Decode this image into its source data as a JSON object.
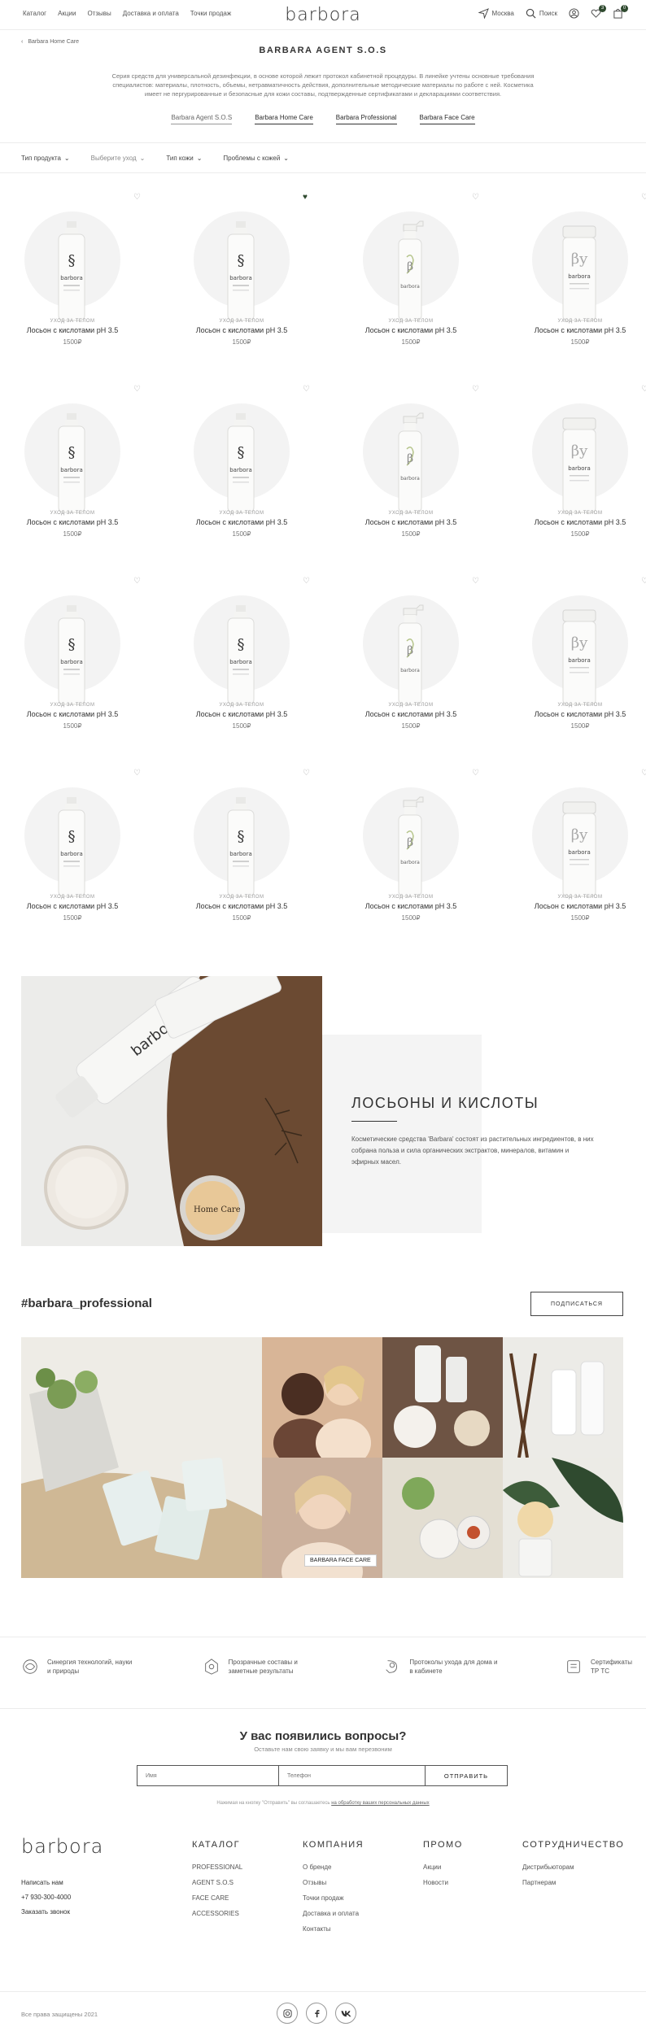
{
  "header": {
    "nav": [
      "Каталог",
      "Акции",
      "Отзывы",
      "Доставка и оплата",
      "Точки продаж"
    ],
    "logo": "barbora",
    "city": "Москва",
    "search": "Поиск",
    "fav_count": "3",
    "cart_count": "0"
  },
  "breadcrumb": "Barbara Home Care",
  "page": {
    "title": "BARBARA AGENT S.O.S",
    "description": "Серия средств для универсальной дезинфекции, в основе которой лежит протокол кабинетной процедуры. В линейке учтены основные требования специалистов: материалы, плотность, объемы, нетравматичность действия, дополнительные методические материалы по работе с ней. Косметика имеет не пергурированные и безопасные для кожи составы, подтвержденные сертификатами и декларациями соответствия.",
    "tabs": [
      "Barbara Agent S.O.S",
      "Barbara Home Care",
      "Barbara Professional",
      "Barbara Face Care"
    ]
  },
  "filters": [
    "Тип продукта",
    "Выберите уход",
    "Тип кожи",
    "Проблемы с кожей"
  ],
  "products": [
    {
      "category": "уход за телом",
      "name": "Лосьон с кислотами pH 3.5",
      "price": "1500₽",
      "kind": "agent",
      "fav": false
    },
    {
      "category": "уход за телом",
      "name": "Лосьон с кислотами pH 3.5",
      "price": "1500₽",
      "kind": "agent",
      "fav": true
    },
    {
      "category": "уход за телом",
      "name": "Лосьон с кислотами pH 3.5",
      "price": "1500₽",
      "kind": "spray",
      "fav": false
    },
    {
      "category": "уход за телом",
      "name": "Лосьон с кислотами pH 3.5",
      "price": "1500₽",
      "kind": "jar",
      "fav": false
    },
    {
      "category": "уход за телом",
      "name": "Лосьон с кислотами pH 3.5",
      "price": "1500₽",
      "kind": "agent",
      "fav": false
    },
    {
      "category": "уход за телом",
      "name": "Лосьон с кислотами pH 3.5",
      "price": "1500₽",
      "kind": "agent",
      "fav": false
    },
    {
      "category": "уход за телом",
      "name": "Лосьон с кислотами pH 3.5",
      "price": "1500₽",
      "kind": "spray",
      "fav": false
    },
    {
      "category": "уход за телом",
      "name": "Лосьон с кислотами pH 3.5",
      "price": "1500₽",
      "kind": "jar",
      "fav": false
    },
    {
      "category": "уход за телом",
      "name": "Лосьон с кислотами pH 3.5",
      "price": "1500₽",
      "kind": "agent",
      "fav": false
    },
    {
      "category": "уход за телом",
      "name": "Лосьон с кислотами pH 3.5",
      "price": "1500₽",
      "kind": "agent",
      "fav": false
    },
    {
      "category": "уход за телом",
      "name": "Лосьон с кислотами pH 3.5",
      "price": "1500₽",
      "kind": "spray",
      "fav": false
    },
    {
      "category": "уход за телом",
      "name": "Лосьон с кислотами pH 3.5",
      "price": "1500₽",
      "kind": "jar",
      "fav": false
    },
    {
      "category": "уход за телом",
      "name": "Лосьон с кислотами pH 3.5",
      "price": "1500₽",
      "kind": "agent",
      "fav": false
    },
    {
      "category": "уход за телом",
      "name": "Лосьон с кислотами pH 3.5",
      "price": "1500₽",
      "kind": "agent",
      "fav": false
    },
    {
      "category": "уход за телом",
      "name": "Лосьон с кислотами pH 3.5",
      "price": "1500₽",
      "kind": "spray",
      "fav": false
    },
    {
      "category": "уход за телом",
      "name": "Лосьон с кислотами pH 3.5",
      "price": "1500₽",
      "kind": "jar",
      "fav": false
    }
  ],
  "bottle_text": {
    "agent": "barbora",
    "spray": "barbora",
    "jar": "barbora"
  },
  "banner": {
    "title": "ЛОСЬОНЫ И КИСЛОТЫ",
    "text": "Косметические средства 'Barbara' состоят из растительных ингредиентов, в них собрана польза и сила органических экстрактов, минералов, витамин и эфирных масел.",
    "jar_label": "Home Care"
  },
  "instagram": {
    "title": "#barbara_professional",
    "subscribe": "ПОДПИСАТЬСЯ",
    "tag": "BARBARA FACE CARE"
  },
  "features": [
    {
      "icon": "synergy-icon",
      "text": "Синергия технологий, науки и природы"
    },
    {
      "icon": "formula-icon",
      "text": "Прозрачные составы и заметные результаты"
    },
    {
      "icon": "protocol-icon",
      "text": "Протоколы ухода для дома и в кабинете"
    },
    {
      "icon": "certificate-icon",
      "text": "Сертификаты ТР ТС"
    }
  ],
  "questions": {
    "title": "У вас появились вопросы?",
    "subtitle": "Оставьте нам свою заявку и мы вам перезвоним",
    "name_placeholder": "Имя",
    "phone_placeholder": "Телефон",
    "submit": "ОТПРАВИТЬ",
    "note_prefix": "Нажимая на кнопку \"Отправить\" вы соглашаетесь ",
    "note_link": "на обработку ваших персональных данных"
  },
  "footer": {
    "logo": "barbora",
    "write_us": "Написать нам",
    "phone": "+7 930-300-4000",
    "callback": "Заказать звонок",
    "columns": [
      {
        "title": "КАТАЛОГ",
        "links": [
          "PROFESSIONAL",
          "AGENT S.O.S",
          "FACE CARE",
          "ACCESSORIES"
        ]
      },
      {
        "title": "КОМПАНИЯ",
        "links": [
          "О бренде",
          "Отзывы",
          "Точки продаж",
          "Доставка и оплата",
          "Контакты"
        ]
      },
      {
        "title": "ПРОМО",
        "links": [
          "Акции",
          "Новости"
        ]
      },
      {
        "title": "СОТРУДНИЧЕСТВО",
        "links": [
          "Дистрибьюторам",
          "Партнерам"
        ]
      }
    ],
    "copyright": "Все права защищены 2021",
    "socials": [
      "instagram-icon",
      "facebook-icon",
      "vk-icon"
    ]
  },
  "colors": {
    "accent": "#2f4a2f",
    "brown": "#6b4a32",
    "border": "#ececec"
  }
}
